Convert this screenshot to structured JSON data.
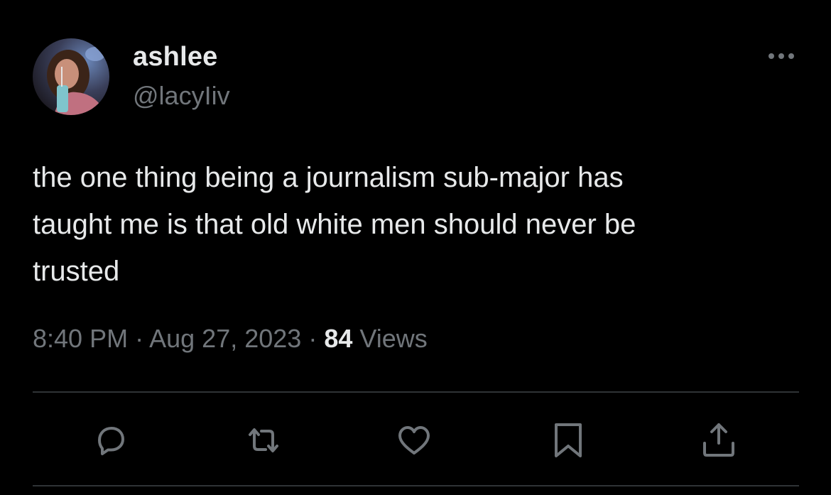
{
  "tweet": {
    "author": {
      "display_name": "ashlee",
      "handle": "@lacyIiv",
      "avatar_icon": "profile-photo"
    },
    "text": "the one thing being a journalism sub-major has\ntaught me is that old white men should never be\ntrusted",
    "time": "8:40 PM",
    "separator": "·",
    "date": "Aug 27, 2023",
    "views_count": "84",
    "views_label": "Views"
  },
  "actions": {
    "reply_icon": "reply-icon",
    "retweet_icon": "retweet-icon",
    "like_icon": "heart-icon",
    "bookmark_icon": "bookmark-icon",
    "share_icon": "share-icon",
    "more_icon": "more-icon"
  },
  "colors": {
    "background": "#000000",
    "primary_text": "#e7e9ea",
    "secondary_text": "#71767b",
    "divider": "#2f3336"
  }
}
